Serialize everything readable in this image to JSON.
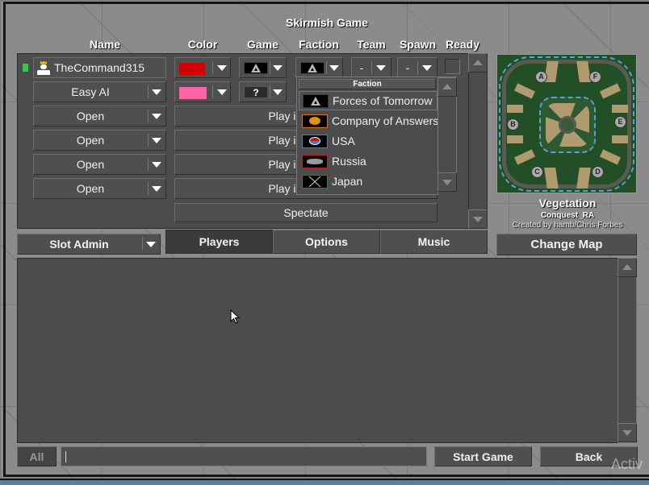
{
  "window": {
    "title": "Skirmish Game"
  },
  "columns": {
    "name": "Name",
    "color": "Color",
    "game": "Game",
    "faction": "Faction",
    "team": "Team",
    "spawn": "Spawn",
    "ready": "Ready"
  },
  "slots": [
    {
      "name": "TheCommand315",
      "status_color": "#2ecc40",
      "color": "#d40000",
      "game_icon": "forces-of-tomorrow-icon",
      "faction_icon": "forces-of-tomorrow-icon",
      "team": "-",
      "spawn": "-",
      "ready": false
    },
    {
      "name": "Easy AI",
      "color": "#ff62a5",
      "game_icon": "random-icon",
      "game_label": "?"
    },
    {
      "name": "Open",
      "action": "Play in this slot"
    },
    {
      "name": "Open",
      "action": "Play in this slot"
    },
    {
      "name": "Open",
      "action": "Play in this slot"
    },
    {
      "name": "Open",
      "action": "Play in this slot"
    }
  ],
  "spectate_label": "Spectate",
  "faction_dropdown": {
    "header": "Faction",
    "options": [
      {
        "label": "Forces of Tomorrow",
        "icon": "forces-of-tomorrow-icon",
        "border": "#3a3a3a",
        "selected": true
      },
      {
        "label": "Company of Answers",
        "icon": "company-of-answers-icon",
        "border": "#e07020"
      },
      {
        "label": "USA",
        "icon": "usa-icon",
        "border": "#2a8fc8"
      },
      {
        "label": "Russia",
        "icon": "russia-icon",
        "border": "#c02020"
      },
      {
        "label": "Japan",
        "icon": "japan-icon",
        "border": "#1a8a3a"
      }
    ]
  },
  "map": {
    "title": "Vegetation",
    "mod": "Conquest_RA",
    "author": "Created by hamb/Chris Forbes",
    "spawns": [
      "A",
      "F",
      "B",
      "E",
      "C",
      "D"
    ],
    "change_map_label": "Change Map"
  },
  "slot_admin_label": "Slot Admin",
  "tabs": [
    {
      "label": "Players",
      "active": true
    },
    {
      "label": "Options",
      "active": false
    },
    {
      "label": "Music",
      "active": false
    }
  ],
  "chat": {
    "channel_label": "All",
    "input_value": ""
  },
  "buttons": {
    "start_game": "Start Game",
    "back": "Back"
  },
  "watermark": "Activ"
}
